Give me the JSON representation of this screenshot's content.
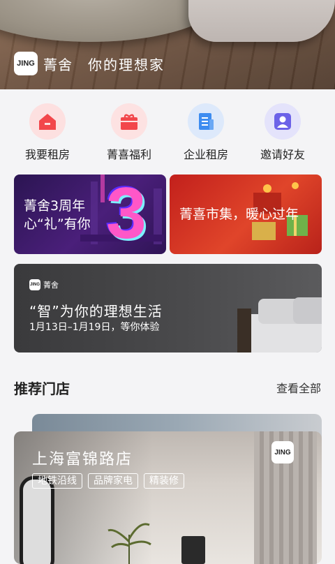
{
  "hero": {
    "logo_text": "JING",
    "brand_name": "菁舍",
    "slogan": "你的理想家"
  },
  "quick_nav": [
    {
      "label": "我要租房",
      "icon": "house-icon",
      "color": "#f2474b"
    },
    {
      "label": "菁喜福利",
      "icon": "gift-icon",
      "color": "#f2474b"
    },
    {
      "label": "企业租房",
      "icon": "document-icon",
      "color": "#3d8cf0"
    },
    {
      "label": "邀请好友",
      "icon": "user-icon",
      "color": "#6c62e8"
    }
  ],
  "promos": {
    "anniversary": {
      "line1": "菁舍3周年",
      "line2": "心“礼”有你",
      "big_text": "3"
    },
    "market": {
      "title": "菁喜市集，暖心过年"
    }
  },
  "event_banner": {
    "logo_text": "JING",
    "brand_name": "菁舍",
    "title": "“智”为你的理想生活",
    "dates": "1月13日–1月19日，等你体验"
  },
  "recommended": {
    "title": "推荐门店",
    "more_label": "查看全部",
    "store": {
      "name": "上海富锦路店",
      "logo_text": "JING",
      "tags": [
        "地铁沿线",
        "品牌家电",
        "精装修"
      ]
    }
  }
}
